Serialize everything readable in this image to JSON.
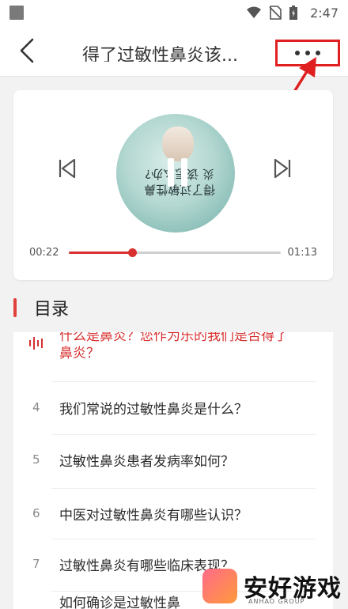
{
  "status_bar": {
    "time": "2:47",
    "icons": [
      "wifi-icon",
      "no-sim-icon",
      "battery-icon"
    ]
  },
  "header": {
    "title": "得了过敏性鼻炎该...",
    "back_icon": "chevron-left-icon",
    "more_icon": "more-horizontal-icon"
  },
  "player": {
    "cover_text": "得了过敏性鼻炎 该怎么办?",
    "current_time": "00:22",
    "total_time": "01:13",
    "progress": 0.3
  },
  "toc": {
    "title": "目录",
    "items": [
      {
        "num": "",
        "text_line1": "什么是鼻炎？您作为乐的我们是否得了",
        "text_line2": "鼻炎？",
        "active": true
      },
      {
        "num": "4",
        "text": "我们常说的过敏性鼻炎是什么？",
        "active": false
      },
      {
        "num": "5",
        "text": "过敏性鼻炎患者发病率如何？",
        "active": false
      },
      {
        "num": "6",
        "text": "中医对过敏性鼻炎有哪些认识？",
        "active": false
      },
      {
        "num": "7",
        "text": "过敏性鼻炎有哪些临床表现？",
        "active": false
      },
      {
        "num": "",
        "text": "如何确诊是过敏性鼻",
        "active": false
      }
    ]
  },
  "watermark": {
    "text": "安好游戏",
    "sub": "ANHAO GROUP"
  },
  "colors": {
    "accent": "#d6302f",
    "annotation": "#e02020"
  }
}
